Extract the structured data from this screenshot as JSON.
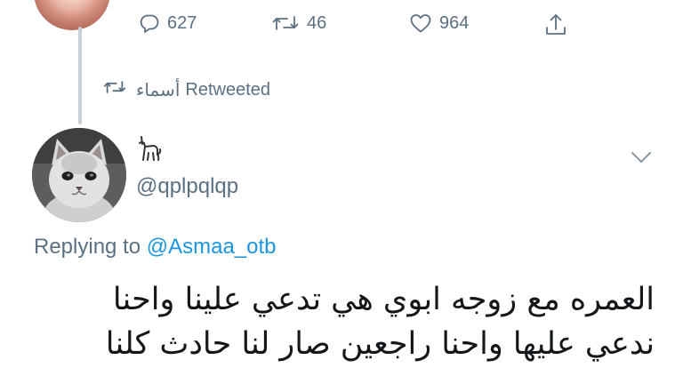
{
  "tweet_actions": {
    "replies_count": "627",
    "retweets_count": "46",
    "likes_count": "964",
    "icons": {
      "reply": "reply-bubble-icon",
      "retweet": "retweet-icon",
      "like": "heart-icon",
      "share": "share-icon"
    }
  },
  "retweet_banner": {
    "retweeter_name": "أسماء",
    "label": "Retweeted",
    "icon": "retweet-icon"
  },
  "author": {
    "handle": "@qplpqlqp",
    "avatar_icon": "cat-avatar",
    "name_icon": "cat-glyph-icon"
  },
  "reply_context": {
    "prefix": "Replying to",
    "mention": "@Asmaa_otb"
  },
  "tweet_body": {
    "lines": [
      "العمره مع زوجه ابوي هي تدعي علينا واحنا",
      "ندعي عليها واحنا راجعين صار لنا حادث كلنا"
    ]
  },
  "colors": {
    "secondary_text": "#5b7083",
    "link": "#1b95e0",
    "primary_text": "#14171a",
    "thread_line": "#c9cfd6"
  }
}
